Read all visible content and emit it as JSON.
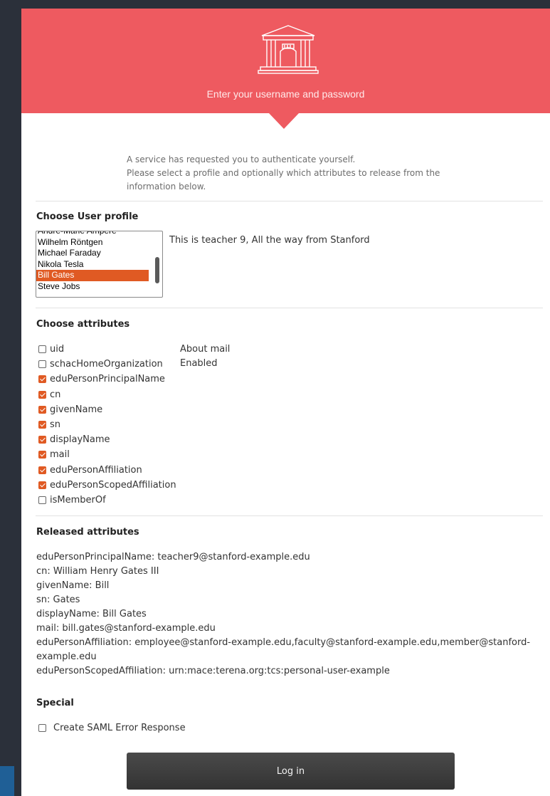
{
  "header": {
    "subtitle": "Enter your username and password",
    "logo_icon": "institution-building-icon",
    "background_color": "#ee5a60"
  },
  "intro": {
    "line1": "A service has requested you to authenticate yourself.",
    "line2": "Please select a profile and optionally which attributes to release from the",
    "line3": "information below."
  },
  "profile": {
    "title": "Choose User profile",
    "options": [
      "André-Marie Ampère",
      "Wilhelm Röntgen",
      "Michael Faraday",
      "Nikola Tesla",
      "Bill Gates",
      "Steve Jobs"
    ],
    "selected": "Bill Gates",
    "description": "This is teacher 9, All the way from Stanford",
    "accent_color": "#e05a23"
  },
  "attributes": {
    "title": "Choose attributes",
    "items": [
      {
        "label": "uid",
        "checked": false
      },
      {
        "label": "schacHomeOrganization",
        "checked": false
      },
      {
        "label": "eduPersonPrincipalName",
        "checked": true
      },
      {
        "label": "cn",
        "checked": true
      },
      {
        "label": "givenName",
        "checked": true
      },
      {
        "label": "sn",
        "checked": true
      },
      {
        "label": "displayName",
        "checked": true
      },
      {
        "label": "mail",
        "checked": true
      },
      {
        "label": "eduPersonAffiliation",
        "checked": true
      },
      {
        "label": "eduPersonScopedAffiliation",
        "checked": true
      },
      {
        "label": "isMemberOf",
        "checked": false
      }
    ],
    "about_title": "About mail",
    "about_status": "Enabled"
  },
  "released": {
    "title": "Released attributes",
    "lines": [
      "eduPersonPrincipalName: teacher9@stanford-example.edu",
      "cn: William Henry Gates III",
      "givenName: Bill",
      "sn: Gates",
      "displayName: Bill Gates",
      "mail: bill.gates@stanford-example.edu",
      "eduPersonAffiliation: employee@stanford-example.edu,faculty@stanford-example.edu,member@stanford-example.edu",
      "eduPersonScopedAffiliation: urn:mace:terena.org:tcs:personal-user-example"
    ]
  },
  "special": {
    "title": "Special",
    "saml_error_label": "Create SAML Error Response",
    "saml_error_checked": false
  },
  "login": {
    "label": "Log in"
  }
}
